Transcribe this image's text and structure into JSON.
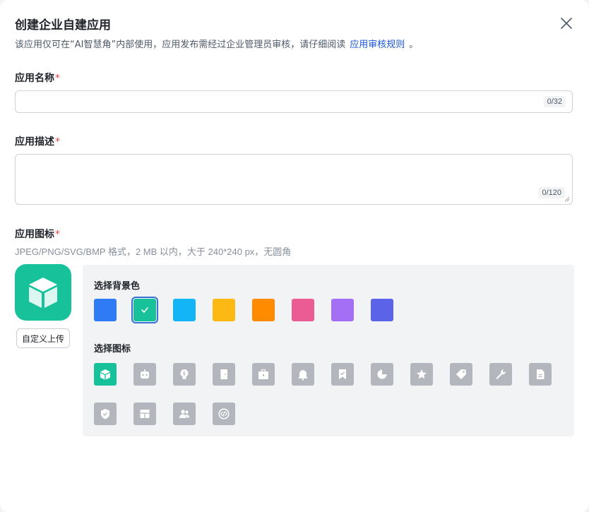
{
  "dialog": {
    "title": "创建企业自建应用",
    "subtitle": "该应用仅可在“AI智慧角”内部使用，应用发布需经过企业管理员审核，请仔细阅读",
    "rules_link": "应用审核规则",
    "subtitle_tail": "。"
  },
  "fields": {
    "name": {
      "label": "应用名称",
      "required_mark": "*",
      "value": "",
      "counter": "0/32"
    },
    "description": {
      "label": "应用描述",
      "required_mark": "*",
      "value": "",
      "counter": "0/120"
    },
    "icon": {
      "label": "应用图标",
      "required_mark": "*",
      "hint": "JPEG/PNG/SVG/BMP 格式，2 MB 以内，大于 240*240 px，无圆角"
    }
  },
  "upload_button": "自定义上传",
  "picker": {
    "bg_label": "选择背景色",
    "icon_label": "选择图标",
    "selected_color_index": 1,
    "selected_icon_index": 0,
    "colors": [
      "#2f7bf6",
      "#17c29a",
      "#14b5f6",
      "#fdb913",
      "#ff8c00",
      "#eb5b94",
      "#a56ff5",
      "#5b64e8"
    ],
    "icons": [
      "cube-icon",
      "robot-icon",
      "lightbulb-icon",
      "door-icon",
      "briefcase-icon",
      "bell-icon",
      "bookmark-check-icon",
      "pie-chart-icon",
      "star-badge-icon",
      "tag-icon",
      "wrench-icon",
      "document-icon",
      "shield-check-icon",
      "layout-icon",
      "users-icon",
      "code-icon"
    ]
  }
}
